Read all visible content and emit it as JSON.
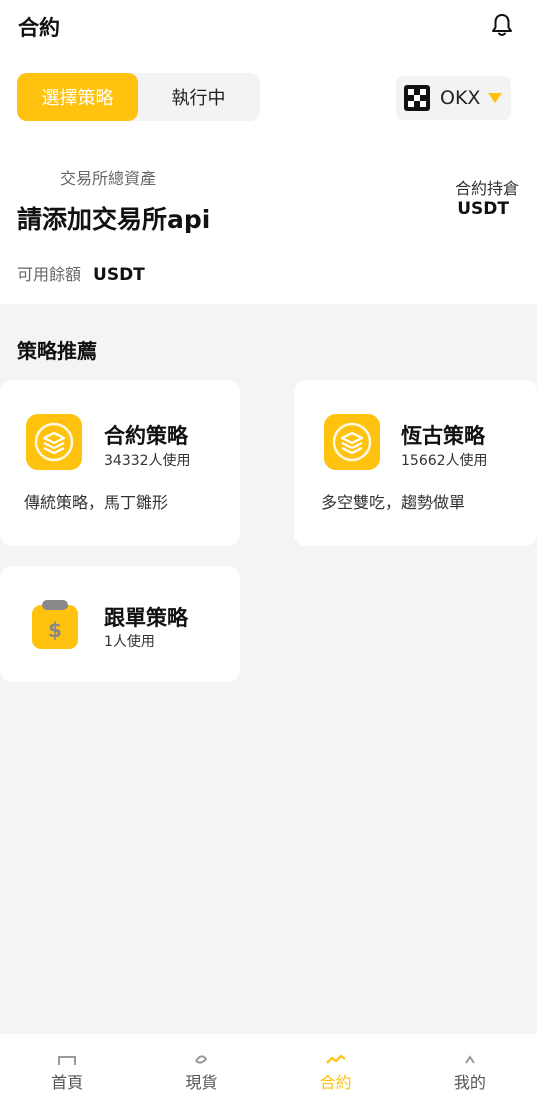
{
  "header": {
    "title": "合約",
    "bell_icon": "bell-icon"
  },
  "segment": {
    "tabs": [
      {
        "label": "選擇策略",
        "active": true
      },
      {
        "label": "執行中",
        "active": false
      }
    ]
  },
  "exchange": {
    "name": "OKX",
    "logo_icon": "okx-logo-icon",
    "dropdown_icon": "caret-down-icon"
  },
  "assets": {
    "label": "交易所總資產",
    "value": "請添加交易所api",
    "position_label": "合約持倉",
    "position_unit": "USDT",
    "available_label": "可用餘額",
    "available_unit": "USDT"
  },
  "strategies": {
    "title": "策略推薦",
    "items": [
      {
        "name": "合約策略",
        "users": "34332人使用",
        "desc": "傳統策略，馬丁雛形",
        "icon": "layers-icon"
      },
      {
        "name": "恆古策略",
        "users": "15662人使用",
        "desc": "多空雙吃，趨勢做單",
        "icon": "layers-icon"
      },
      {
        "name": "跟單策略",
        "users": "1人使用",
        "desc": "",
        "icon": "dollar-clipboard-icon"
      }
    ]
  },
  "tabbar": {
    "items": [
      {
        "label": "首頁",
        "icon": "home-icon",
        "active": false
      },
      {
        "label": "現貨",
        "icon": "spot-icon",
        "active": false
      },
      {
        "label": "合約",
        "icon": "contract-icon",
        "active": true
      },
      {
        "label": "我的",
        "icon": "profile-icon",
        "active": false
      }
    ]
  },
  "colors": {
    "accent": "#ffc20e",
    "background": "#f4f4f5"
  }
}
